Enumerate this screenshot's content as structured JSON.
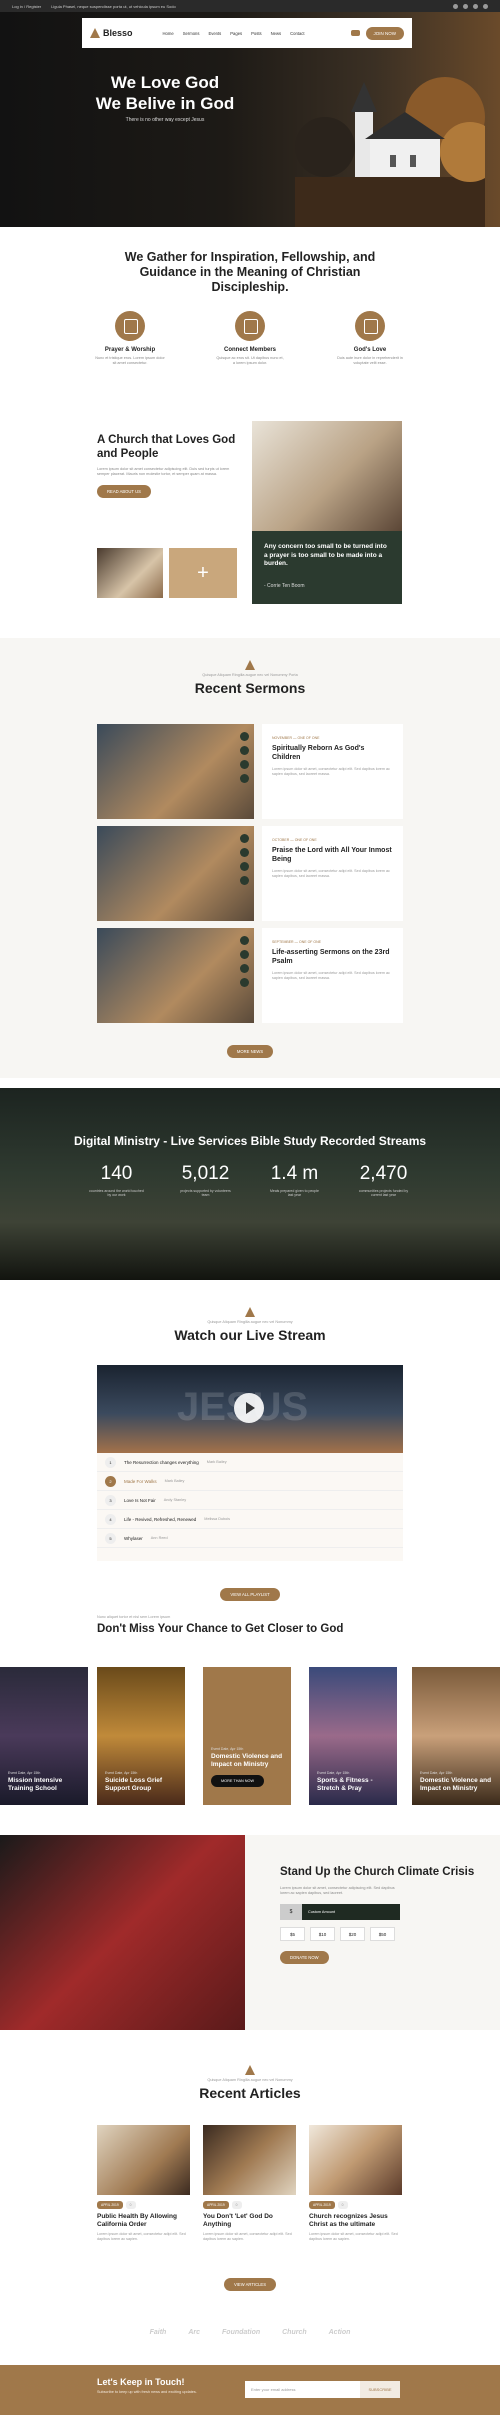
{
  "topbar": {
    "left": "Log in / Register",
    "middle": "Ligula Phasel, neque suspendisse porta ut, ut vehicula ipsum eu Sodo"
  },
  "nav": {
    "logo": "Blesso",
    "links": [
      "Home",
      "Sermons",
      "Events",
      "Pages",
      "Posts",
      "News",
      "Contact"
    ],
    "join": "JOIN NOW"
  },
  "hero": {
    "title_line1": "We Love God",
    "title_line2": "We Belive in God",
    "subtitle": "There is no other way except Jesus"
  },
  "gather": {
    "title": "We Gather for Inspiration, Fellowship, and Guidance in the Meaning of Christian Discipleship.",
    "features": [
      {
        "title": "Prayer & Worship",
        "icon": "prayer-icon",
        "text": "Nunc et tristique eros. Lorem ipsum dolor sit amet consectetur."
      },
      {
        "title": "Connect Members",
        "icon": "members-icon",
        "text": "Quisque ac eros sit. Ut dapibus nunc et, a lorem ipsum dolor."
      },
      {
        "title": "God's Love",
        "icon": "heart-icon",
        "text": "Duis aute irure dolor in reprehenderit in voluptate velit esse."
      }
    ]
  },
  "about": {
    "title": "A Church that Loves God and People",
    "text": "Lorem ipsum dolor sit amet consectetur adipiscing elit. Duis sed turpis ut lorem semper placerat. Mauris non molestie tortor, et semper quam at massa.",
    "button": "Read about us",
    "quote": "Any concern too small to be turned into a prayer is too small to be made into a burden.",
    "author": "- Corrie Ten Boom"
  },
  "sermons": {
    "eyebrow": "Quisque Aliquam Ringilla augue nec vel Nonummy Porta",
    "title": "Recent Sermons",
    "items": [
      {
        "meta": "NOVEMBER — ONE OF ONE",
        "title": "Spiritually Reborn As God's Children",
        "text": "Lorem ipsum dolor sit amet, consectetur adipi elit. Sed dapibus lorem ac sapien dapibus, sed laoreet massa."
      },
      {
        "meta": "OCTOBER — ONE OF ONE",
        "title": "Praise the Lord with All Your Inmost Being",
        "text": "Lorem ipsum dolor sit amet, consectetur adipi elit. Sed dapibus lorem ac sapien dapibus, sed laoreet massa."
      },
      {
        "meta": "SEPTEMBER — ONE OF ONE",
        "title": "Life-asserting Sermons on the 23rd Psalm",
        "text": "Lorem ipsum dolor sit amet, consectetur adipi elit. Sed dapibus lorem ac sapien dapibus, sed laoreet massa."
      }
    ],
    "more": "More news"
  },
  "ministry": {
    "title": "Digital Ministry - Live Services Bible Study Recorded Streams",
    "stats": [
      {
        "value": "140",
        "label": "countries around the world touched by our work"
      },
      {
        "value": "5,012",
        "label": "projects supported by volunteers team"
      },
      {
        "value": "1.4 m",
        "label": "Meals prepared given to people last year"
      },
      {
        "value": "2,470",
        "label": "communities projects funded by current last year"
      }
    ]
  },
  "live": {
    "eyebrow": "Quisque Aliquam Ringilla augue nec vel Nonummy",
    "title": "Watch our Live Stream",
    "video_word": "JESUS",
    "tracks": [
      {
        "title": "The Resurrection changes everything",
        "author": "Mark Bailey"
      },
      {
        "title": "Made For Walks",
        "author": "Mark Bailey"
      },
      {
        "title": "Love Is Not Fair",
        "author": "Andy Stanley"
      },
      {
        "title": "Life - Revived, Refreshed, Renewed",
        "author": "Melissa Dubois"
      },
      {
        "title": "Whylaser",
        "author": "Ann Reed"
      }
    ],
    "more": "View all playlist"
  },
  "chance": {
    "eyebrow": "Nunc aliquet tortor et nisl sem Lorem ipsum",
    "title": "Don't Miss Your Chance to Get Closer to God",
    "cards": [
      {
        "date": "Event Date, Apr 15th",
        "title": "Mission Intensive Training School"
      },
      {
        "date": "Event Date, Apr 15th",
        "title": "Suicide Loss Grief Support Group"
      },
      {
        "date": "Event Date, Apr 15th",
        "title": "Domestic Violence and Impact on Ministry",
        "button": "more than now"
      },
      {
        "date": "Event Date, Apr 15th",
        "title": "Sports & Fitness - Stretch & Pray"
      },
      {
        "date": "Event Date, Apr 15th",
        "title": "Domestic Violence and Impact on Ministry"
      }
    ]
  },
  "crisis": {
    "title": "Stand Up the Church Climate Crisis",
    "text": "Lorem ipsum dolor sit amet, consectetur adipiscing elit. Sed dapibus lorem ac sapien dapibus, sed laoreet.",
    "currency": "$",
    "amount_placeholder": "Custom Amount",
    "options": [
      "$5",
      "$10",
      "$20",
      "$50"
    ],
    "button": "Donate Now"
  },
  "articles": {
    "eyebrow": "Quisque Aliquam Ringilla augue nec vel Nonummy",
    "title": "Recent Articles",
    "items": [
      {
        "tag": "APRIL 2019",
        "comments": "0",
        "title": "Public Health By Allowing California Order",
        "text": "Lorem ipsum dolor sit amet, consectetur adipi elit. Sed dapibus lorem ac sapien."
      },
      {
        "tag": "APRIL 2019",
        "comments": "0",
        "title": "You Don't 'Let' God Do Anything",
        "text": "Lorem ipsum dolor sit amet, consectetur adipi elit. Sed dapibus lorem ac sapien."
      },
      {
        "tag": "APRIL 2019",
        "comments": "0",
        "title": "Church recognizes Jesus Christ as the ultimate",
        "text": "Lorem ipsum dolor sit amet, consectetur adipi elit. Sed dapibus lorem ac sapien."
      }
    ],
    "more": "View articles"
  },
  "partners": [
    "Faith",
    "Arc",
    "Foundation",
    "Church",
    "Action"
  ],
  "footer": {
    "title": "Let's Keep in Touch!",
    "text": "Subscribe to keep up with fresh news and exciting updates.",
    "placeholder": "Enter your email address",
    "button": "SUBSCRIBE"
  }
}
